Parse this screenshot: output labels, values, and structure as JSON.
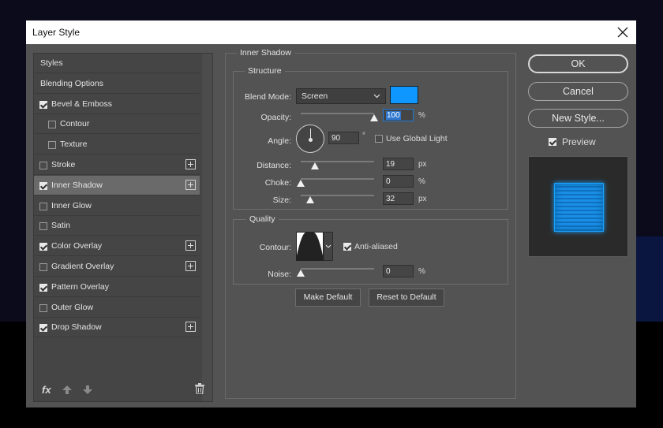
{
  "window": {
    "title": "Layer Style"
  },
  "styles_list": {
    "items": [
      {
        "label": "Styles",
        "type": "header",
        "checked": false,
        "has_add": false,
        "active": false
      },
      {
        "label": "Blending Options",
        "type": "header",
        "checked": false,
        "has_add": false,
        "active": false
      },
      {
        "label": "Bevel & Emboss",
        "type": "effect",
        "checked": true,
        "has_add": false,
        "active": false
      },
      {
        "label": "Contour",
        "type": "sub",
        "checked": false,
        "has_add": false,
        "active": false
      },
      {
        "label": "Texture",
        "type": "sub",
        "checked": false,
        "has_add": false,
        "active": false
      },
      {
        "label": "Stroke",
        "type": "effect",
        "checked": false,
        "has_add": true,
        "active": false
      },
      {
        "label": "Inner Shadow",
        "type": "effect",
        "checked": true,
        "has_add": true,
        "active": true
      },
      {
        "label": "Inner Glow",
        "type": "effect",
        "checked": false,
        "has_add": false,
        "active": false
      },
      {
        "label": "Satin",
        "type": "effect",
        "checked": false,
        "has_add": false,
        "active": false
      },
      {
        "label": "Color Overlay",
        "type": "effect",
        "checked": true,
        "has_add": true,
        "active": false
      },
      {
        "label": "Gradient Overlay",
        "type": "effect",
        "checked": false,
        "has_add": true,
        "active": false
      },
      {
        "label": "Pattern Overlay",
        "type": "effect",
        "checked": true,
        "has_add": false,
        "active": false
      },
      {
        "label": "Outer Glow",
        "type": "effect",
        "checked": false,
        "has_add": false,
        "active": false
      },
      {
        "label": "Drop Shadow",
        "type": "effect",
        "checked": true,
        "has_add": true,
        "active": false
      }
    ],
    "footer": {
      "fx_label": "fx"
    }
  },
  "inner_shadow": {
    "section_title": "Inner Shadow",
    "structure": {
      "title": "Structure",
      "blend_mode": {
        "label": "Blend Mode:",
        "value": "Screen",
        "color": "#0d97ff"
      },
      "opacity": {
        "label": "Opacity:",
        "value": "100",
        "unit": "%",
        "level": 1.0
      },
      "angle": {
        "label": "Angle:",
        "value": "90",
        "unit": "°",
        "global_light_label": "Use Global Light",
        "global_light": false
      },
      "distance": {
        "label": "Distance:",
        "value": "19",
        "unit": "px",
        "level": 0.19
      },
      "choke": {
        "label": "Choke:",
        "value": "0",
        "unit": "%",
        "level": 0.0
      },
      "size": {
        "label": "Size:",
        "value": "32",
        "unit": "px",
        "level": 0.13
      }
    },
    "quality": {
      "title": "Quality",
      "contour": {
        "label": "Contour:",
        "anti_aliased_label": "Anti-aliased",
        "anti_aliased": true
      },
      "noise": {
        "label": "Noise:",
        "value": "0",
        "unit": "%",
        "level": 0.0
      }
    },
    "buttons": {
      "make_default": "Make Default",
      "reset_default": "Reset to Default"
    }
  },
  "actions": {
    "ok": "OK",
    "cancel": "Cancel",
    "new_style": "New Style...",
    "preview_label": "Preview",
    "preview_checked": true,
    "preview_color": "#1aa3ff"
  }
}
